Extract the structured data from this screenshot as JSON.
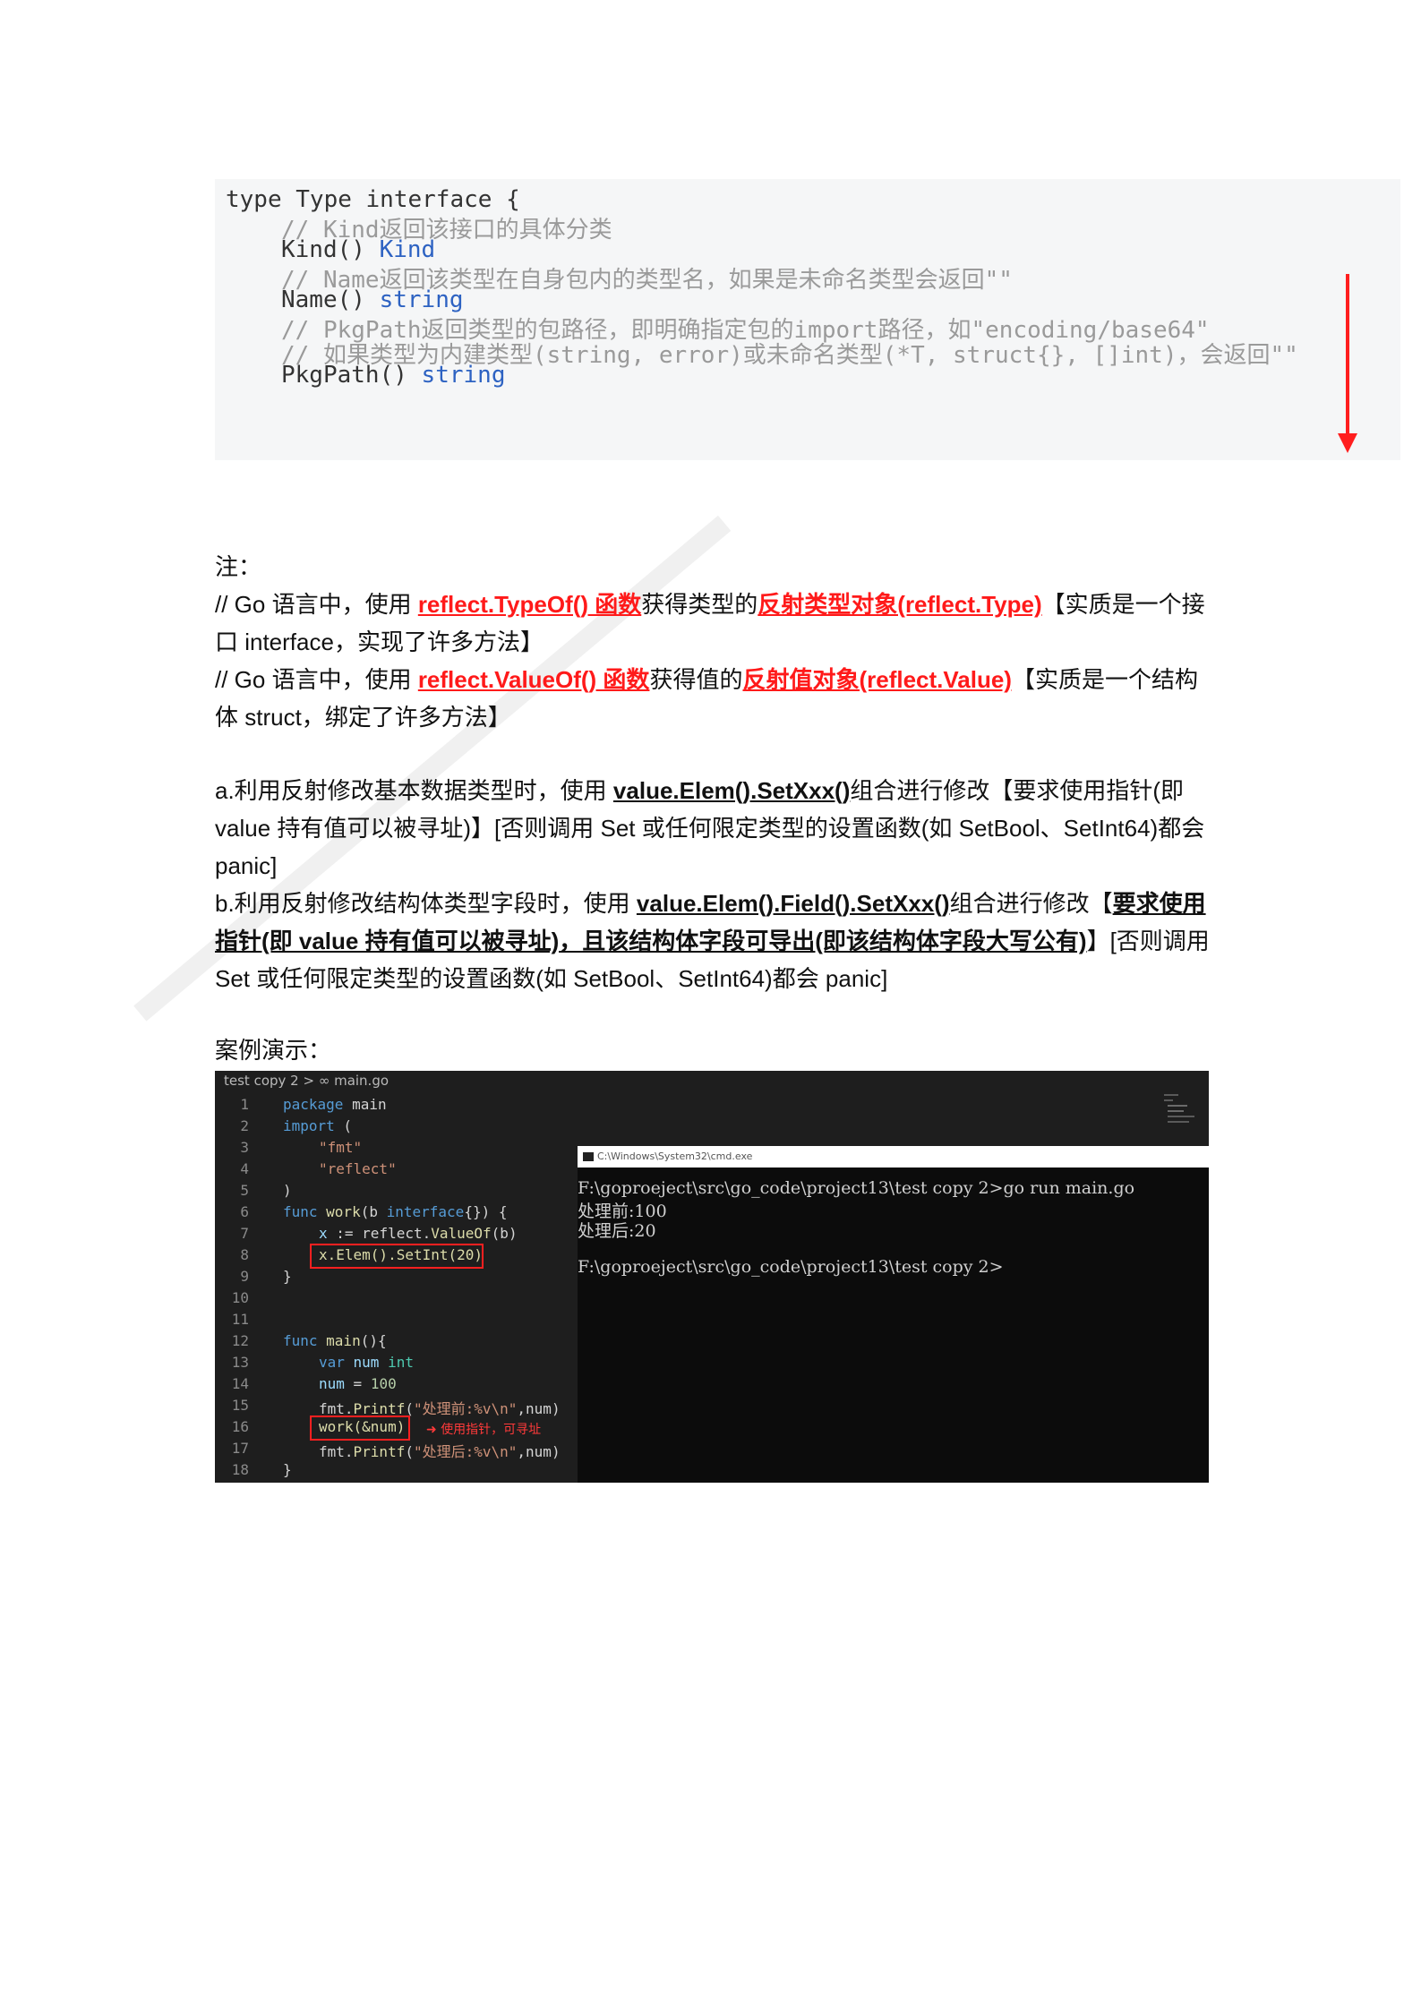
{
  "code_top": {
    "lines": [
      "type Type interface {",
      "// Kind返回该接口的具体分类",
      "Kind()",
      "Kind",
      "// Name返回该类型在自身包内的类型名，如果是未命名类型会返回\"\"",
      "Name()",
      "string",
      "// PkgPath返回类型的包路径，即明确指定包的import路径，如\"encoding/base64\"",
      "// 如果类型为内建类型(string, error)或未命名类型(*T, struct{}, []int)，会返回\"\"",
      "PkgPath()",
      "string"
    ]
  },
  "notes": {
    "label": "注：",
    "p1_a": "// Go 语言中，使用 ",
    "p1_b": "reflect.TypeOf() 函数",
    "p1_c": "获得类型的",
    "p1_d": "反射类型对象(reflect.Type)",
    "p1_e": "【实质是一个接口 interface，实现了许多方法】",
    "p2_a": "// Go 语言中，使用 ",
    "p2_b": "reflect.ValueOf() 函数",
    "p2_c": "获得值的",
    "p2_d": "反射值对象(reflect.Value)",
    "p2_e": "【实质是一个结构体 struct，绑定了许多方法】",
    "a_1": "a.利用反射修改基本数据类型时，使用 ",
    "a_2": "value.Elem().SetXxx()",
    "a_3": "组合进行修改【要求使用指针(即 value 持有值可以被寻址)】[否则调用 Set 或任何限定类型的设置函数(如 SetBool、SetInt64)都会 panic]",
    "b_1": "b.利用反射修改结构体类型字段时，使用 ",
    "b_2": "value.Elem().Field().SetXxx()",
    "b_3": "组合进行修改【",
    "b_4": "要求使用指针(即 value 持有值可以被寻址)，且该结构体字段可导出(即该结构体字段大写公有)",
    "b_5": "】[否则调用 Set 或任何限定类型的设置函数(如 SetBool、SetInt64)都会 panic]",
    "demo_label": "案例演示："
  },
  "demo": {
    "breadcrumb": "test copy 2 > ∞ main.go",
    "line_numbers": [
      "1",
      "2",
      "3",
      "4",
      "5",
      "6",
      "7",
      "8",
      "9",
      "10",
      "11",
      "12",
      "13",
      "14",
      "15",
      "16",
      "17",
      "18"
    ],
    "code": {
      "l1_kw": "package",
      "l1_rest": " main",
      "l2_kw": "import",
      "l2_rest": " (",
      "l3": "\"fmt\"",
      "l4": "\"reflect\"",
      "l5": ")",
      "l6_kw": "func",
      "l6_fn": " work",
      "l6_a": "(b ",
      "l6_ty": "interface",
      "l6_b": "{}) {",
      "l7_var": "x",
      "l7_a": " := reflect.",
      "l7_fn": "ValueOf",
      "l7_b": "(b)",
      "l8": "x.Elem().SetInt(20)",
      "l9": "}",
      "l12_kw": "func",
      "l12_fn": " main",
      "l12_b": "(){",
      "l13_kw": "var",
      "l13_var": " num",
      "l13_ty": " int",
      "l14_var": "num",
      "l14_a": " = ",
      "l14_num": "100",
      "l15_a": "fmt.",
      "l15_fn": "Printf",
      "l15_b": "(",
      "l15_str": "\"处理前:%v\\n\"",
      "l15_c": ",num)",
      "l16": "work(&num)",
      "l16_note": "使用指针，可寻址",
      "l17_a": "fmt.",
      "l17_fn": "Printf",
      "l17_b": "(",
      "l17_str": "\"处理后:%v\\n\"",
      "l17_c": ",num)",
      "l18": "}"
    },
    "cmd_title": "C:\\Windows\\System32\\cmd.exe",
    "cmd_lines": [
      "F:\\goproeject\\src\\go_code\\project13\\test copy 2>go run main.go",
      "处理前:100",
      "处理后:20",
      "F:\\goproeject\\src\\go_code\\project13\\test copy 2>"
    ]
  },
  "colors": {
    "accent_red": "#ff1a1a",
    "code_bg": "#f5f6f7",
    "editor_bg": "#1e1e1e",
    "cmd_bg": "#0c0c0c"
  }
}
